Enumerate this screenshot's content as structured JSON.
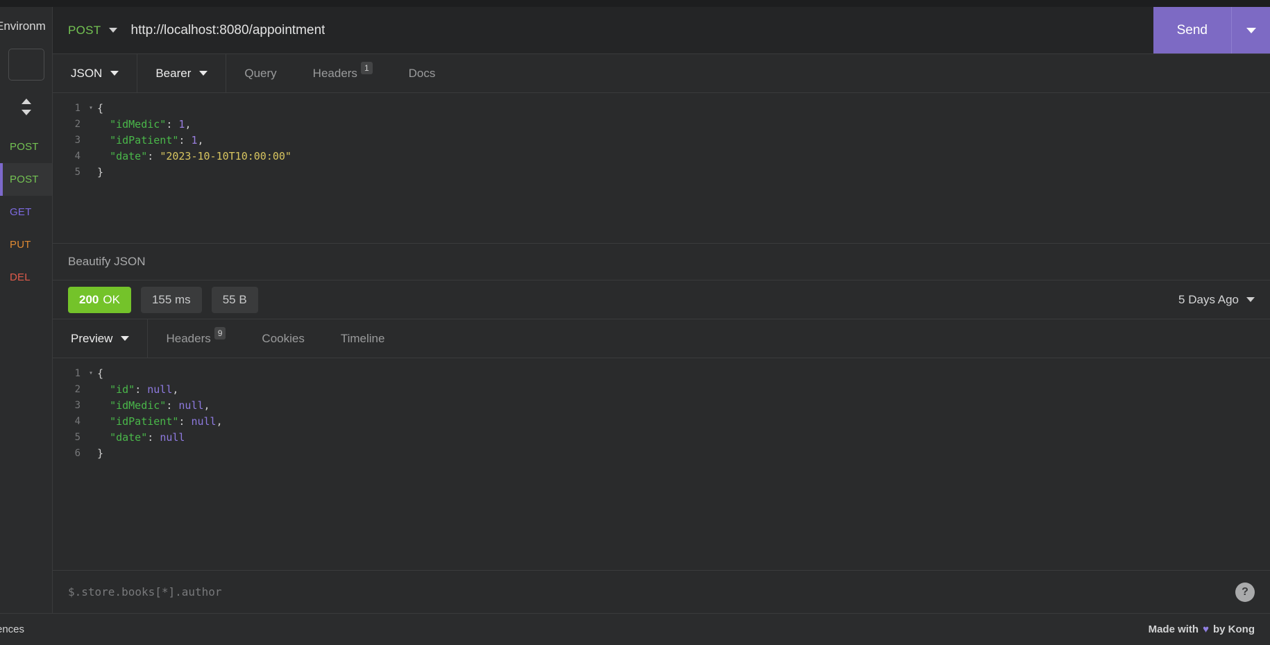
{
  "sidebar": {
    "environment_label": "Environm",
    "search_placeholder": "",
    "sort_icon": "sort-updown-icon",
    "items": [
      {
        "method": "POST",
        "active": false
      },
      {
        "method": "POST",
        "active": true
      },
      {
        "method": "GET",
        "active": false
      },
      {
        "method": "PUT",
        "active": false
      },
      {
        "method": "DEL",
        "active": false
      }
    ]
  },
  "urlbar": {
    "method": "POST",
    "url": "http://localhost:8080/appointment",
    "send_label": "Send"
  },
  "request_tabs": [
    {
      "label": "JSON",
      "active": true,
      "caret": true,
      "badge": ""
    },
    {
      "label": "Bearer",
      "active": true,
      "caret": true,
      "badge": ""
    },
    {
      "label": "Query",
      "active": false,
      "caret": false,
      "badge": ""
    },
    {
      "label": "Headers",
      "active": false,
      "caret": false,
      "badge": "1"
    },
    {
      "label": "Docs",
      "active": false,
      "caret": false,
      "badge": ""
    }
  ],
  "request_body": {
    "lines": [
      {
        "num": "1",
        "fold": "▾",
        "text": "{"
      },
      {
        "num": "2",
        "fold": "",
        "text": "  \"idMedic\": 1,"
      },
      {
        "num": "3",
        "fold": "",
        "text": "  \"idPatient\": 1,"
      },
      {
        "num": "4",
        "fold": "",
        "text": "  \"date\": \"2023-10-10T10:00:00\""
      },
      {
        "num": "5",
        "fold": "",
        "text": "}"
      }
    ]
  },
  "beautify": {
    "label": "Beautify JSON"
  },
  "status": {
    "code": "200",
    "code_text": "OK",
    "time": "155 ms",
    "size": "55 B",
    "history": "5 Days Ago"
  },
  "response_tabs": [
    {
      "label": "Preview",
      "active": true,
      "caret": true,
      "badge": ""
    },
    {
      "label": "Headers",
      "active": false,
      "caret": false,
      "badge": "9"
    },
    {
      "label": "Cookies",
      "active": false,
      "caret": false,
      "badge": ""
    },
    {
      "label": "Timeline",
      "active": false,
      "caret": false,
      "badge": ""
    }
  ],
  "response_body": {
    "lines": [
      {
        "num": "1",
        "fold": "▾",
        "text": "{"
      },
      {
        "num": "2",
        "fold": "",
        "text": "  \"id\": null,"
      },
      {
        "num": "3",
        "fold": "",
        "text": "  \"idMedic\": null,"
      },
      {
        "num": "4",
        "fold": "",
        "text": "  \"idPatient\": null,"
      },
      {
        "num": "5",
        "fold": "",
        "text": "  \"date\": null"
      },
      {
        "num": "6",
        "fold": "",
        "text": "}"
      }
    ]
  },
  "filter": {
    "placeholder": "$.store.books[*].author",
    "value": "",
    "help_label": "?"
  },
  "footer": {
    "left_label": "rences",
    "made_with_prefix": "Made with",
    "heart": "♥",
    "made_with_suffix": "by Kong"
  },
  "colors": {
    "accent": "#7d6ac4",
    "ok": "#74c32a",
    "post": "#74c353",
    "get": "#7d6ae0",
    "put": "#e08a33",
    "del": "#e05b4b"
  }
}
